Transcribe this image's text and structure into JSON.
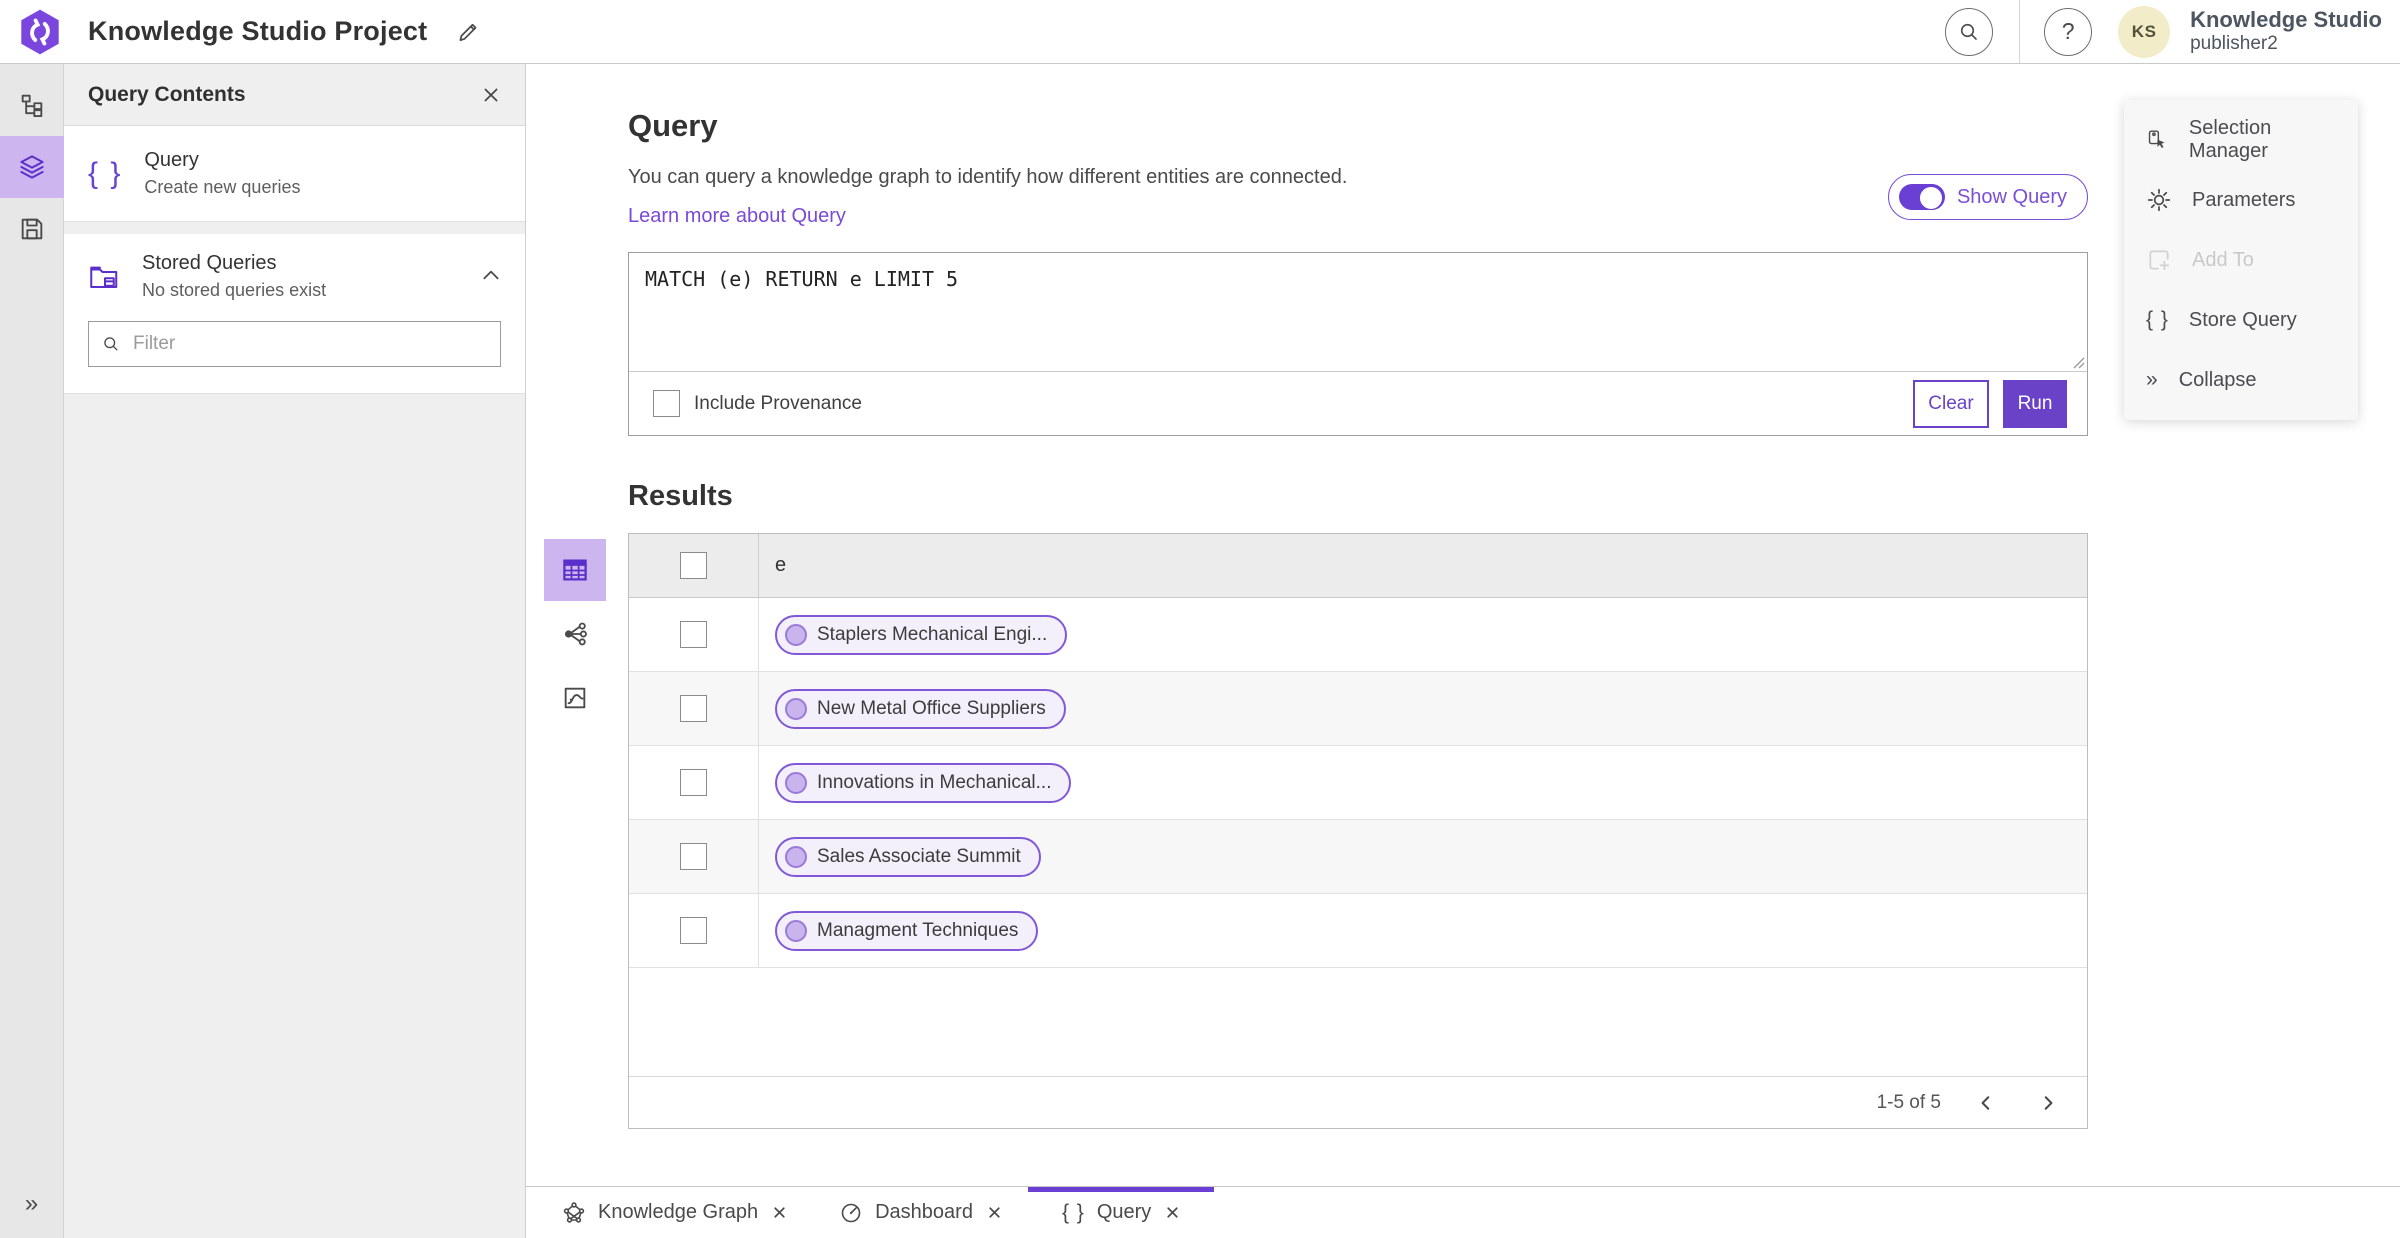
{
  "colors": {
    "accent": "#6a42c8",
    "accent_light": "#cdb6f0",
    "avatar_bg": "#f2ecc8",
    "pill_border": "#8159d8"
  },
  "icons": {
    "braces": "{ }",
    "collapse": "»",
    "help": "?"
  },
  "topbar": {
    "title": "Knowledge Studio Project",
    "account_name": "Knowledge Studio",
    "account_user": "publisher2",
    "avatar_initials": "KS"
  },
  "panel": {
    "title": "Query Contents",
    "query_item": {
      "label": "Query",
      "sublabel": "Create new queries"
    },
    "stored_item": {
      "label": "Stored Queries",
      "sublabel": "No stored queries exist"
    },
    "filter_placeholder": "Filter"
  },
  "query": {
    "heading": "Query",
    "description": "You can query a knowledge graph to identify how different entities are connected.",
    "show_query_label": "Show Query",
    "learn_more_label": "Learn more about Query",
    "text": "MATCH (e) RETURN e LIMIT 5",
    "include_provenance_label": "Include Provenance",
    "clear_label": "Clear",
    "run_label": "Run"
  },
  "results": {
    "heading": "Results",
    "column_header": "e",
    "rows": [
      "Staplers Mechanical Engi...",
      "New Metal Office Suppliers",
      "Innovations in Mechanical...",
      "Sales Associate Summit",
      "Managment Techniques"
    ],
    "pagination_label": "1-5 of 5"
  },
  "side_menu": {
    "items": [
      {
        "label": "Selection Manager",
        "disabled": false
      },
      {
        "label": "Parameters",
        "disabled": false
      },
      {
        "label": "Add To",
        "disabled": true
      },
      {
        "label": "Store Query",
        "disabled": false
      },
      {
        "label": "Collapse",
        "disabled": false
      }
    ]
  },
  "tabs": [
    {
      "label": "Knowledge Graph",
      "active": false
    },
    {
      "label": "Dashboard",
      "active": false
    },
    {
      "label": "Query",
      "active": true
    }
  ]
}
